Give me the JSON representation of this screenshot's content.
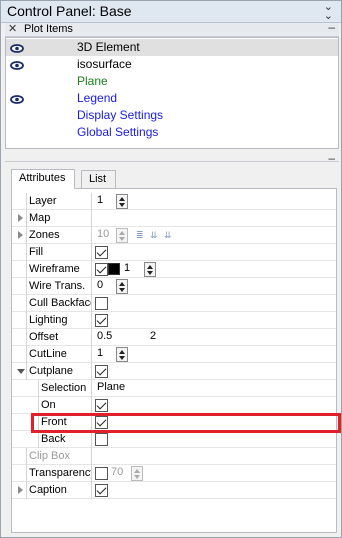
{
  "window": {
    "title": "Control Panel: Base"
  },
  "plot_items": {
    "header": "Plot Items",
    "items": [
      {
        "label": "3D Element",
        "visible": true,
        "color": "#000000",
        "selected": true
      },
      {
        "label": "isosurface",
        "visible": true,
        "color": "#000000",
        "selected": false
      },
      {
        "label": "Plane",
        "visible": false,
        "color": "#1a7f1a",
        "selected": false
      },
      {
        "label": "Legend",
        "visible": true,
        "color": "#1a1ae0",
        "selected": false
      },
      {
        "label": "Display Settings",
        "visible": false,
        "color": "#1a1ae0",
        "selected": false
      },
      {
        "label": "Global Settings",
        "visible": false,
        "color": "#1a1ae0",
        "selected": false
      }
    ]
  },
  "tabs": {
    "attributes": "Attributes",
    "list": "List",
    "active": "Attributes"
  },
  "attributes": {
    "layer": {
      "label": "Layer",
      "value": "1"
    },
    "map": {
      "label": "Map"
    },
    "zones": {
      "label": "Zones",
      "value": "10"
    },
    "fill": {
      "label": "Fill",
      "checked": true
    },
    "wireframe": {
      "label": "Wireframe",
      "checked": true,
      "color": "#000000",
      "value": "1"
    },
    "wire_trans": {
      "label": "Wire Trans.",
      "value": "0"
    },
    "cull_backface": {
      "label": "Cull Backface",
      "checked": false
    },
    "lighting": {
      "label": "Lighting",
      "checked": true
    },
    "offset": {
      "label": "Offset",
      "value1": "0.5",
      "value2": "2"
    },
    "cutline": {
      "label": "CutLine",
      "value": "1"
    },
    "cutplane": {
      "label": "Cutplane",
      "checked": true
    },
    "selection": {
      "label": "Selection",
      "value": "Plane"
    },
    "on": {
      "label": "On",
      "checked": true
    },
    "front": {
      "label": "Front",
      "checked": true
    },
    "back": {
      "label": "Back",
      "checked": false
    },
    "clip_box": {
      "label": "Clip Box"
    },
    "transparency": {
      "label": "Transparency",
      "checked": false,
      "value": "70"
    },
    "caption": {
      "label": "Caption",
      "checked": true
    }
  },
  "highlight_color": "#e0202a"
}
